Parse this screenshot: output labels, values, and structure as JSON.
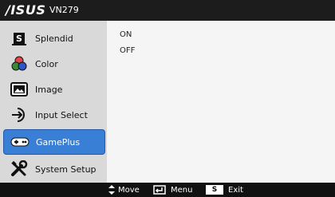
{
  "header": {
    "brand": "/ISUS",
    "model": "VN279"
  },
  "menu": [
    {
      "label": "Splendid",
      "icon": "splendid-icon"
    },
    {
      "label": "Color",
      "icon": "color-icon"
    },
    {
      "label": "Image",
      "icon": "image-icon"
    },
    {
      "label": "Input Select",
      "icon": "input-select-icon"
    },
    {
      "label": "GamePlus",
      "icon": "gameplus-icon",
      "active": true
    },
    {
      "label": "System Setup",
      "icon": "system-setup-icon"
    }
  ],
  "options": [
    "ON",
    "OFF"
  ],
  "footer": {
    "move": "Move",
    "menu": "Menu",
    "exit": "Exit",
    "s_key": "S"
  },
  "colors": {
    "sidebar_bg": "#d9d9d9",
    "active_bg": "#3a7fd6",
    "content_bg": "#f5f5f5",
    "bar_bg": "#111111"
  }
}
